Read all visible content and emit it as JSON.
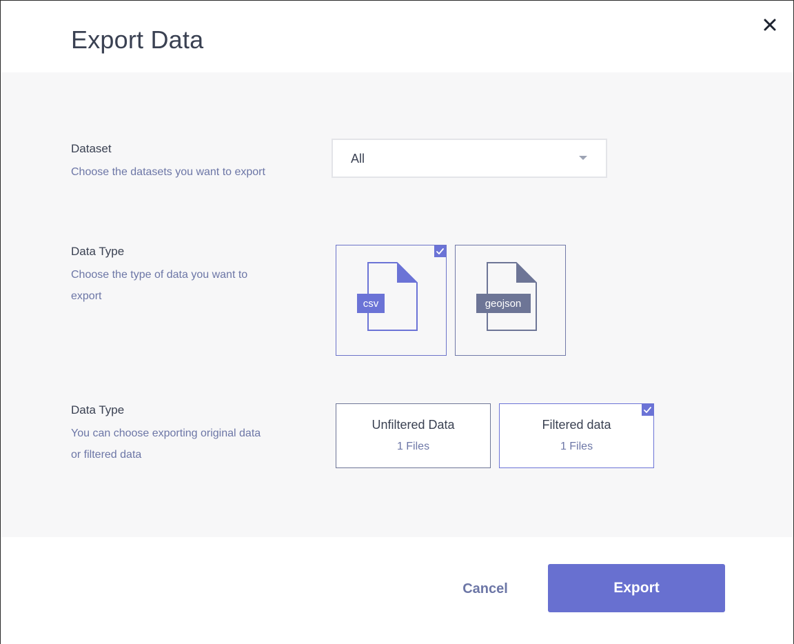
{
  "dialog": {
    "title": "Export Data",
    "close_icon": "close-icon"
  },
  "dataset": {
    "label": "Dataset",
    "description": "Choose the datasets you want to export",
    "selected": "All",
    "caret_icon": "caret-down-icon"
  },
  "data_type": {
    "label": "Data Type",
    "description": "Choose the type of data you want to export",
    "options": [
      {
        "label": "csv",
        "selected": true,
        "icon": "csv-file-icon"
      },
      {
        "label": "geojson",
        "selected": false,
        "icon": "geojson-file-icon"
      }
    ]
  },
  "filter": {
    "label": "Data Type",
    "description": "You can choose exporting original data or filtered data",
    "options": [
      {
        "name": "Unfiltered Data",
        "count": "1 Files",
        "selected": false
      },
      {
        "name": "Filtered data",
        "count": "1 Files",
        "selected": true
      }
    ]
  },
  "footer": {
    "cancel_label": "Cancel",
    "export_label": "Export"
  },
  "colors": {
    "accent": "#6870d0",
    "label_text": "#3a4152",
    "description_text": "#6c76a6",
    "body_background": "#f7f7f8"
  }
}
